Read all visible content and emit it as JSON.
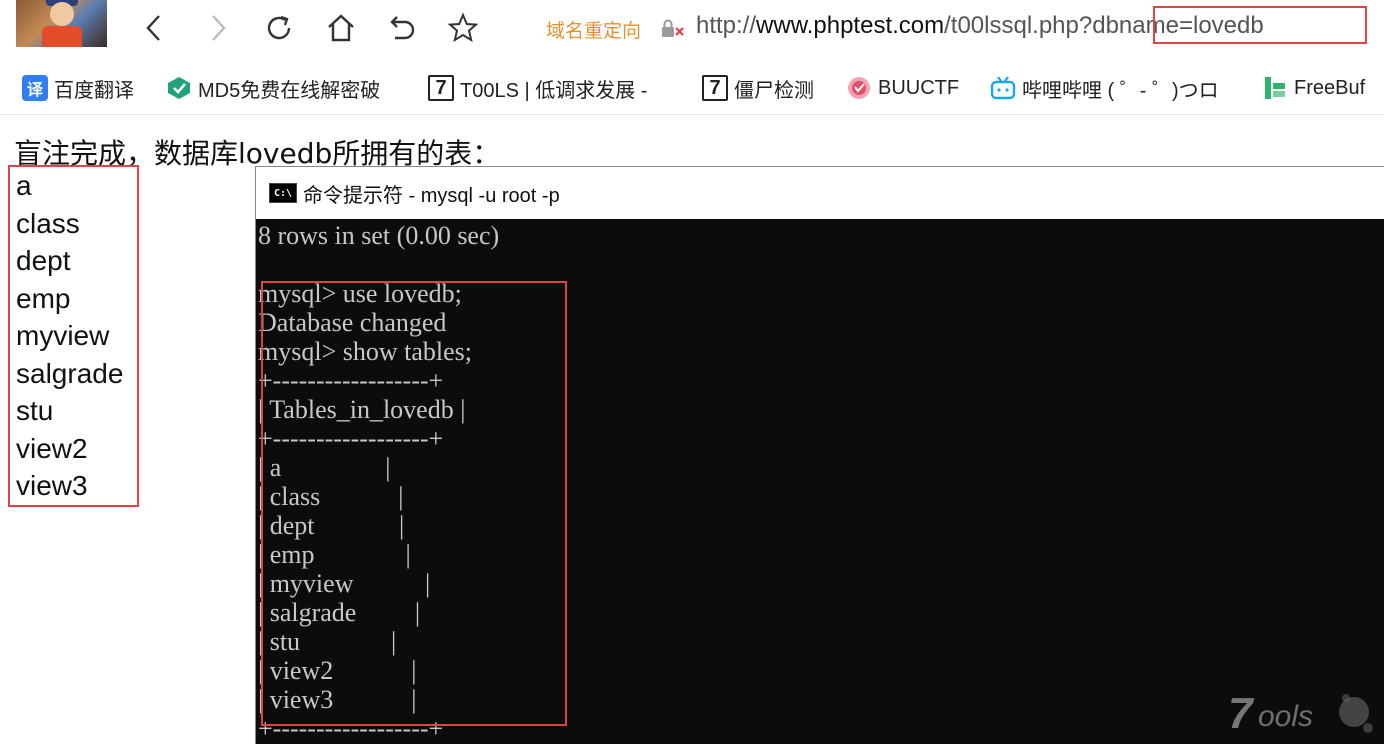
{
  "toolbar": {
    "redirect_label": "域名重定向",
    "url_scheme": "http://",
    "url_host": "www.phptest.com",
    "url_path": "/t00lssql.php?",
    "url_query": "dbname=lovedb"
  },
  "bookmarks": [
    {
      "label": "百度翻译",
      "icon": "translate-icon",
      "icon_text": "译",
      "color": "#2f7ff0"
    },
    {
      "label": "MD5免费在线解密破",
      "icon": "md5-icon",
      "icon_text": "",
      "color": "#1fa37d"
    },
    {
      "label": "T00LS | 低调求发展 -",
      "icon": "t00ls-icon",
      "icon_text": "7",
      "color": "#222222"
    },
    {
      "label": "僵尸检测",
      "icon": "t00ls-icon",
      "icon_text": "7",
      "color": "#222222"
    },
    {
      "label": "BUUCTF",
      "icon": "buuctf-icon",
      "icon_text": "",
      "color": "#e0506a"
    },
    {
      "label": "哔哩哔哩 ( ゜- ゜)つロ",
      "icon": "bilibili-icon",
      "icon_text": "",
      "color": "#1aa7e6"
    },
    {
      "label": "FreeBuf",
      "icon": "freebuf-icon",
      "icon_text": "",
      "color": "#2db36b"
    }
  ],
  "page": {
    "heading": "盲注完成，数据库lovedb所拥有的表：",
    "tables": [
      "a",
      "class",
      "dept",
      "emp",
      "myview",
      "salgrade",
      "stu",
      "view2",
      "view3"
    ]
  },
  "cmd": {
    "title": "命令提示符 - mysql  -u root -p",
    "icon_text": "C:\\",
    "lines": [
      "8 rows in set (0.00 sec)",
      "",
      "mysql> use lovedb;",
      "Database changed",
      "mysql> show tables;",
      "+------------------+",
      "| Tables_in_lovedb |",
      "+------------------+",
      "| a                |",
      "| class            |",
      "| dept             |",
      "| emp              |",
      "| myview           |",
      "| salgrade         |",
      "| stu              |",
      "| view2            |",
      "| view3            |",
      "+------------------+"
    ]
  },
  "watermark": "7ools",
  "colors": {
    "highlight": "#e04343",
    "redirect": "#e8902c",
    "console_bg": "#0c0c0c",
    "console_text": "#c8c8c8"
  }
}
